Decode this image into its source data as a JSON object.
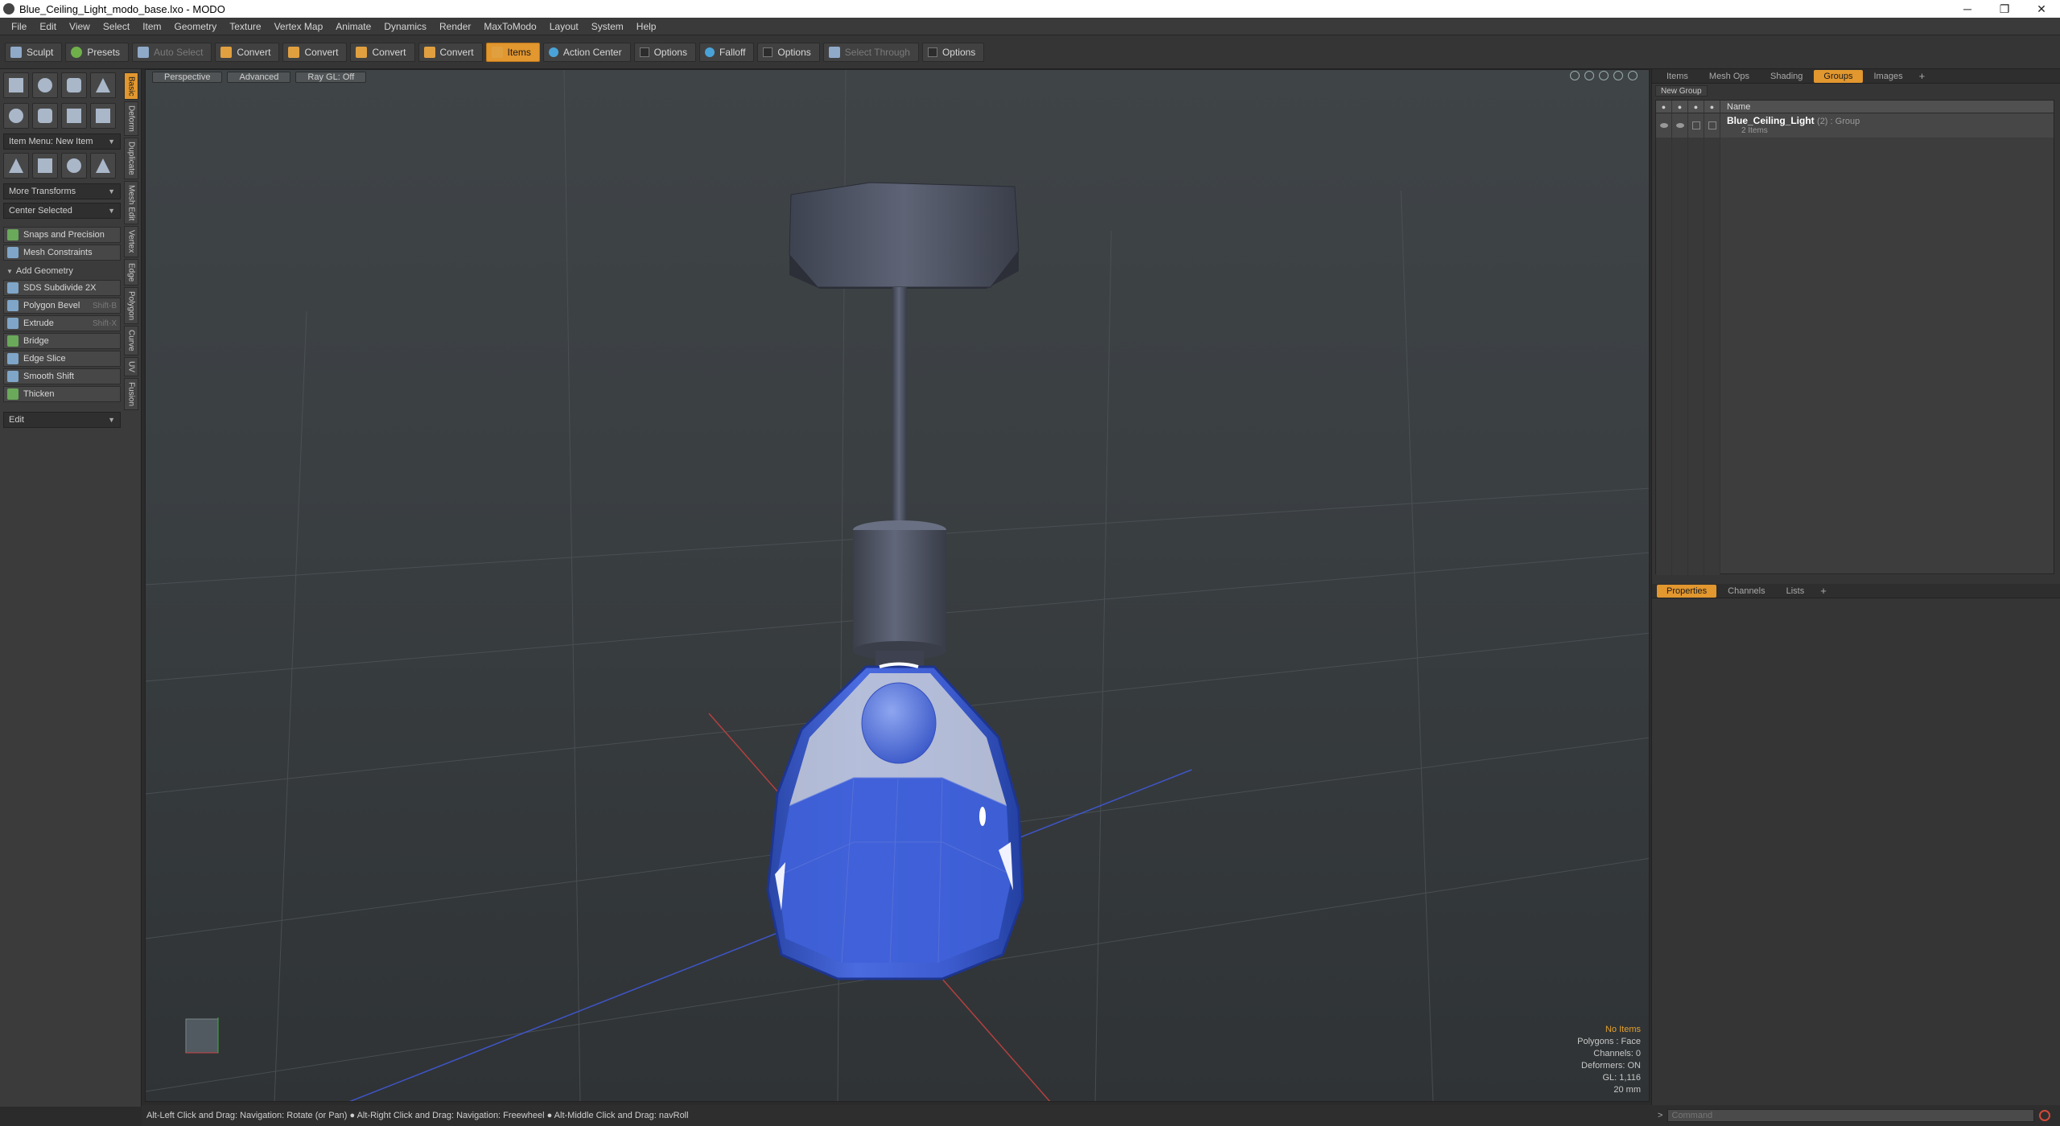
{
  "window": {
    "title": "Blue_Ceiling_Light_modo_base.lxo - MODO",
    "controls": [
      "─",
      "❐",
      "✕"
    ]
  },
  "menu": [
    "File",
    "Edit",
    "View",
    "Select",
    "Item",
    "Geometry",
    "Texture",
    "Vertex Map",
    "Animate",
    "Dynamics",
    "Render",
    "MaxToModo",
    "Layout",
    "System",
    "Help"
  ],
  "toolbar": {
    "sculpt": "Sculpt",
    "presets": "Presets",
    "auto_select": "Auto Select",
    "convert1": "Convert",
    "convert2": "Convert",
    "convert3": "Convert",
    "convert4": "Convert",
    "items": "Items",
    "action_center": "Action Center",
    "options1": "Options",
    "falloff": "Falloff",
    "options2": "Options",
    "select_through": "Select Through",
    "options3": "Options"
  },
  "left": {
    "item_menu": "Item Menu: New Item",
    "more_transforms": "More Transforms",
    "center_selected": "Center Selected",
    "snaps": "Snaps and Precision",
    "mesh_constraints": "Mesh Constraints",
    "add_geometry": "Add Geometry",
    "tools": [
      {
        "label": "SDS Subdivide 2X",
        "shortcut": ""
      },
      {
        "label": "Polygon Bevel",
        "shortcut": "Shift-B"
      },
      {
        "label": "Extrude",
        "shortcut": "Shift-X"
      },
      {
        "label": "Bridge",
        "shortcut": ""
      },
      {
        "label": "Edge Slice",
        "shortcut": ""
      },
      {
        "label": "Smooth Shift",
        "shortcut": ""
      },
      {
        "label": "Thicken",
        "shortcut": ""
      }
    ],
    "edit": "Edit",
    "vtabs": [
      "Basic",
      "Deform",
      "Duplicate",
      "Mesh Edit",
      "Vertex",
      "Edge",
      "Polygon",
      "Curve",
      "UV",
      "Fusion"
    ]
  },
  "viewport": {
    "perspective": "Perspective",
    "advanced": "Advanced",
    "raygl": "Ray GL: Off",
    "info": {
      "no_items": "No Items",
      "polygons": "Polygons : Face",
      "channels": "Channels: 0",
      "deformers": "Deformers: ON",
      "gl": "GL: 1,116",
      "scale": "20 mm"
    },
    "colors": {
      "shade_blue": "#3a5cc8",
      "shade_blue_dark": "#2a46a8",
      "fixture_gray": "#5a5f6e",
      "grid": "#4e5458"
    }
  },
  "status": {
    "text": "Alt-Left Click and Drag: Navigation: Rotate (or Pan) ● Alt-Right Click and Drag: Navigation: Freewheel ● Alt-Middle Click and Drag: navRoll"
  },
  "right": {
    "tabs": [
      "Items",
      "Mesh Ops",
      "Shading",
      "Groups",
      "Images"
    ],
    "active_tab": "Groups",
    "new_group": "New Group",
    "name_header": "Name",
    "group": {
      "name": "Blue_Ceiling_Light",
      "meta": "(2) : Group",
      "count": "2 Items"
    },
    "props_tabs": [
      "Properties",
      "Channels",
      "Lists"
    ],
    "active_props_tab": "Properties"
  },
  "command": {
    "prompt": ">",
    "placeholder": "Command"
  }
}
